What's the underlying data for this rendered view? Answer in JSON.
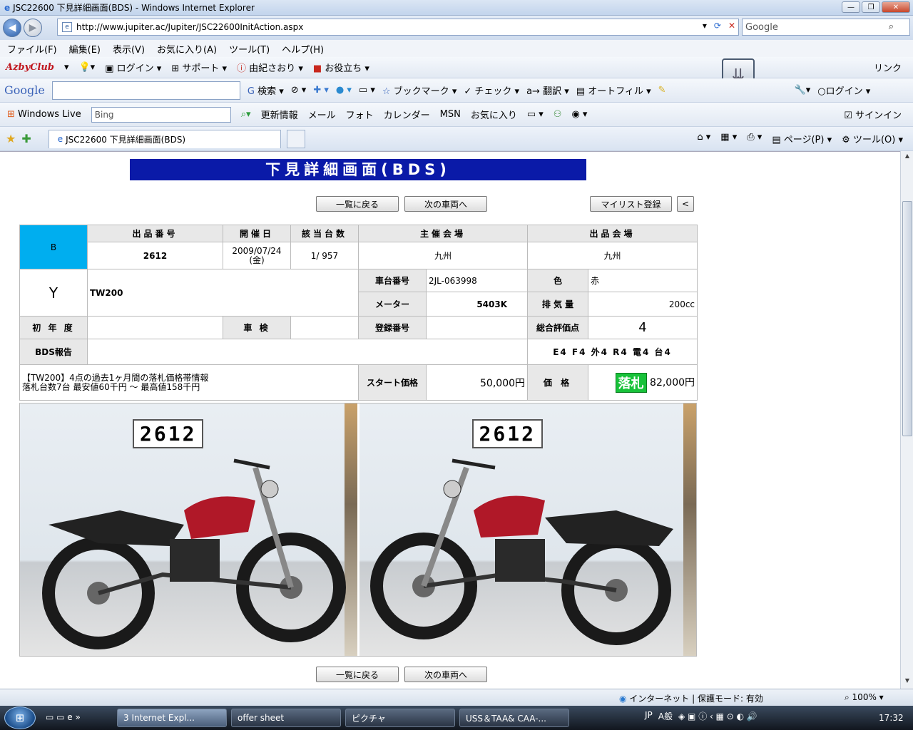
{
  "window": {
    "title": "JSC22600 下見詳細画面(BDS) - Windows Internet Explorer",
    "address": "http://www.jupiter.ac/Jupiter/JSC22600InitAction.aspx",
    "search_value": "Google"
  },
  "menu": [
    "ファイル(F)",
    "編集(E)",
    "表示(V)",
    "お気に入り(A)",
    "ツール(T)",
    "ヘルプ(H)"
  ],
  "toolbar1": {
    "brand": "AzbyClub",
    "login": "ログイン",
    "support": "サポート",
    "user": "由紀さおり",
    "useful": "お役立ち",
    "links": "リンク"
  },
  "toolbar2": {
    "logo": "Google",
    "search": "検索",
    "bookmark": "ブックマーク",
    "check": "チェック",
    "translate": "翻訳",
    "autofill": "オートフィル",
    "login": "ログイン"
  },
  "toolbar3": {
    "brand": "Windows Live",
    "bing_placeholder": "Bing",
    "links": [
      "更新情報",
      "メール",
      "フォト",
      "カレンダー",
      "MSN",
      "お気に入り"
    ],
    "signin": "サインイン"
  },
  "tabs": {
    "active": "JSC22600 下見詳細画面(BDS)",
    "page": "ページ(P)",
    "tools": "ツール(O)"
  },
  "page": {
    "title": "下見詳細画面(BDS)",
    "buttons": {
      "back_list": "一覧に戻る",
      "next_vehicle": "次の車両へ",
      "mylist": "マイリスト登録",
      "prev": "<"
    },
    "headers": {
      "lot_no": "出品番号",
      "date": "開催日",
      "count": "該当台数",
      "host_venue": "主催会場",
      "list_venue": "出品会場"
    },
    "grade": "B",
    "lot_no": "2612",
    "date_line1": "2009/07/24",
    "date_line2": "(金)",
    "count": "1/ 957",
    "host_venue": "九州",
    "list_venue": "九州",
    "maker": "Y",
    "model": "TW200",
    "labels": {
      "chassis": "車台番号",
      "color": "色",
      "meter": "メーター",
      "displacement": "排 気 量",
      "first_year": "初 年 度",
      "inspection": "車 検",
      "registration": "登録番号",
      "overall_score": "総合評価点",
      "bds_report": "BDS報告",
      "start_price": "スタート価格",
      "price": "価 格"
    },
    "chassis": "2JL-063998",
    "color": "赤",
    "meter": "5403K",
    "displacement": "200cc",
    "first_year": "",
    "inspection": "",
    "registration": "",
    "overall_score": "4",
    "bds_report": "",
    "scores": "E4 F4 外4 R4 電4 台4",
    "market_line1": "【TW200】4点の過去1ヶ月間の落札価格帯情報",
    "market_line2": "落札台数7台 最安値60千円 ～ 最高値158千円",
    "start_price": "50,000円",
    "sold_badge": "落札",
    "price": "82,000円",
    "photo_plate": "2612"
  },
  "statusbar": {
    "zone": "インターネット | 保護モード: 有効",
    "zoom": "100%"
  },
  "taskbar": {
    "tasks": [
      "3 Internet Expl...",
      "offer sheet",
      "ピクチャ",
      "USS＆TAA& CAA-..."
    ],
    "lang": "JP",
    "clock": "17:32"
  }
}
